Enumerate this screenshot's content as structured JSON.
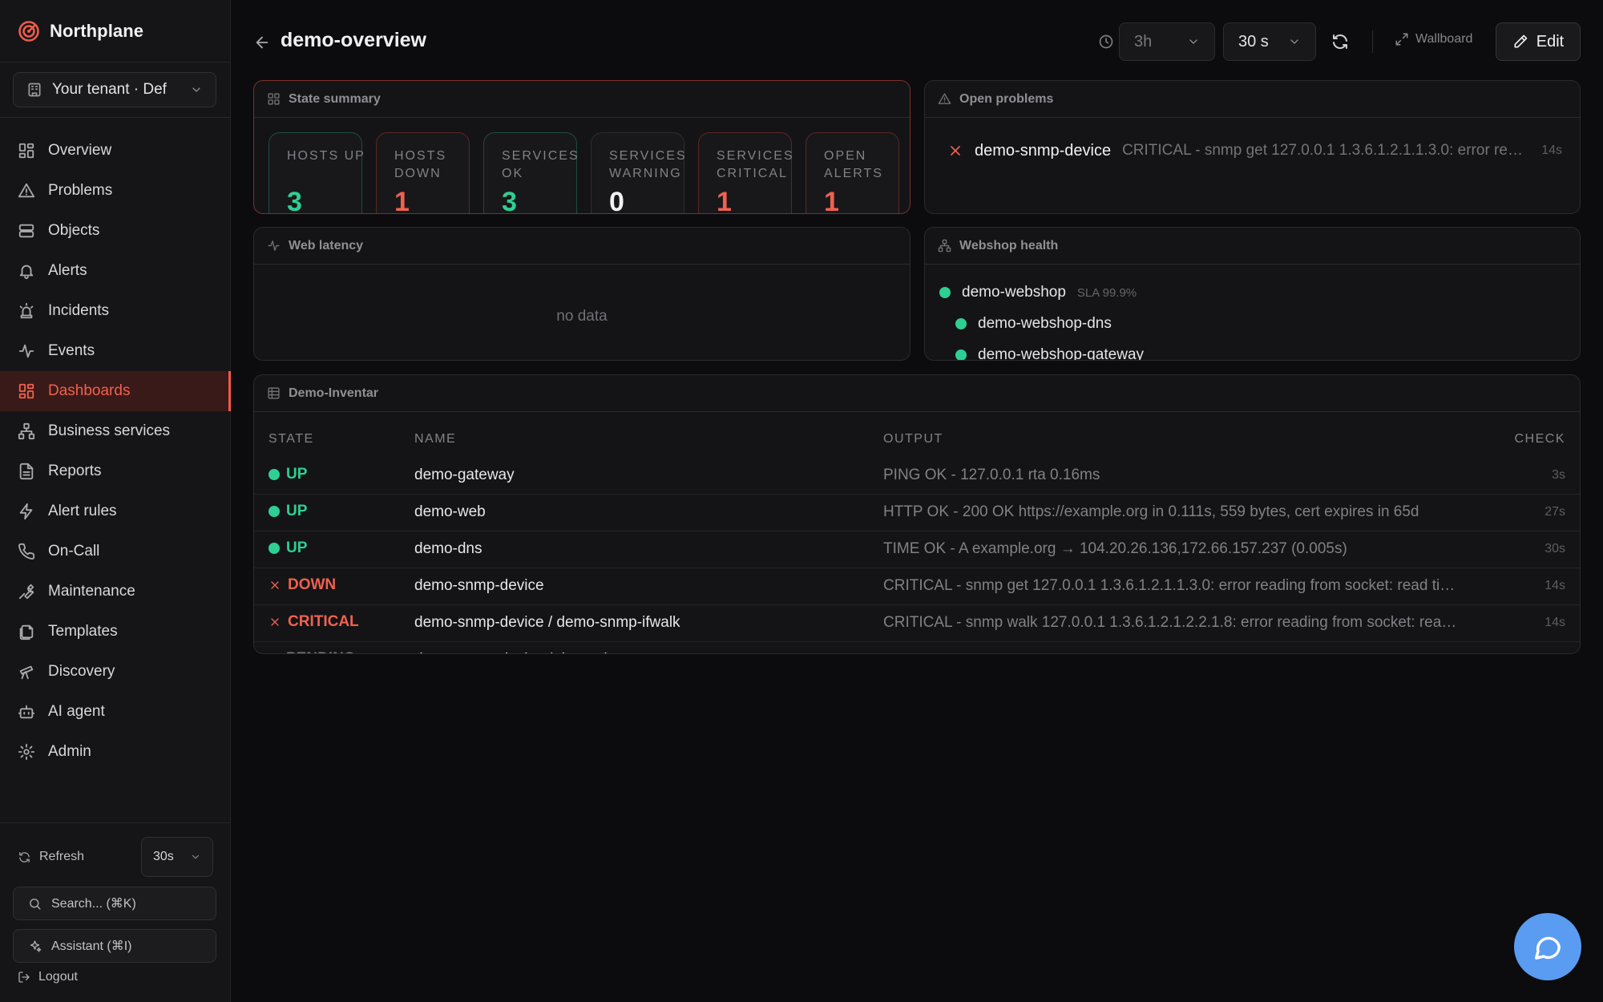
{
  "app": {
    "name": "Northplane"
  },
  "tenant": {
    "label": "Your tenant · Def"
  },
  "nav": [
    {
      "label": "Overview",
      "icon": "layout-dashboard-icon",
      "active": false
    },
    {
      "label": "Problems",
      "icon": "warning-triangle-icon",
      "active": false
    },
    {
      "label": "Objects",
      "icon": "server-icon",
      "active": false
    },
    {
      "label": "Alerts",
      "icon": "bell-icon",
      "active": false
    },
    {
      "label": "Incidents",
      "icon": "siren-icon",
      "active": false
    },
    {
      "label": "Events",
      "icon": "activity-icon",
      "active": false
    },
    {
      "label": "Dashboards",
      "icon": "grid-icon",
      "active": true
    },
    {
      "label": "Business services",
      "icon": "network-icon",
      "active": false
    },
    {
      "label": "Reports",
      "icon": "file-text-icon",
      "active": false
    },
    {
      "label": "Alert rules",
      "icon": "zap-icon",
      "active": false
    },
    {
      "label": "On-Call",
      "icon": "phone-icon",
      "active": false
    },
    {
      "label": "Maintenance",
      "icon": "wrench-icon",
      "active": false
    },
    {
      "label": "Templates",
      "icon": "copy-icon",
      "active": false
    },
    {
      "label": "Discovery",
      "icon": "telescope-icon",
      "active": false
    },
    {
      "label": "AI agent",
      "icon": "bot-icon",
      "active": false
    },
    {
      "label": "Admin",
      "icon": "gear-icon",
      "active": false
    }
  ],
  "sidebar_footer": {
    "refresh_label": "Refresh",
    "refresh_value": "30s",
    "search_placeholder": "Search... (⌘K)",
    "assistant_label": "Assistant (⌘I)",
    "logout_label": "Logout"
  },
  "header": {
    "title": "demo-overview",
    "time_range": "3h",
    "refresh_interval": "30 s",
    "wallboard_label": "Wallboard",
    "edit_label": "Edit"
  },
  "state_summary": {
    "title": "State summary",
    "tiles": [
      {
        "label": "HOSTS UP",
        "value": "3",
        "tone": "green"
      },
      {
        "label": "HOSTS DOWN",
        "value": "1",
        "tone": "red"
      },
      {
        "label": "SERVICES OK",
        "value": "3",
        "tone": "green"
      },
      {
        "label": "SERVICES WARNING",
        "value": "0",
        "tone": "neutral"
      },
      {
        "label": "SERVICES CRITICAL",
        "value": "1",
        "tone": "red"
      },
      {
        "label": "OPEN ALERTS",
        "value": "1",
        "tone": "red"
      }
    ]
  },
  "open_problems": {
    "title": "Open problems",
    "items": [
      {
        "host": "demo-snmp-device",
        "output": "CRITICAL - snmp get 127.0.0.1 1.3.6.1.2.1.1.3.0: error reading from socket: read",
        "age": "14s"
      }
    ]
  },
  "web_latency": {
    "title": "Web latency",
    "empty_text": "no data"
  },
  "webshop_health": {
    "title": "Webshop health",
    "root": {
      "name": "demo-webshop",
      "sla": "SLA 99.9%"
    },
    "children": [
      "demo-webshop-dns",
      "demo-webshop-gateway"
    ]
  },
  "inventory": {
    "title": "Demo-Inventar",
    "columns": [
      "STATE",
      "NAME",
      "OUTPUT",
      "CHECK"
    ],
    "rows": [
      {
        "state": "UP",
        "name": "demo-gateway",
        "output": "PING OK - 127.0.0.1 rta 0.16ms",
        "check": "3s"
      },
      {
        "state": "UP",
        "name": "demo-web",
        "output": "HTTP OK - 200 OK https://example.org in 0.111s, 559 bytes, cert expires in 65d",
        "check": "27s"
      },
      {
        "state": "UP",
        "name": "demo-dns",
        "output": "TIME OK - A example.org → 104.20.26.136,172.66.157.237 (0.005s)",
        "check": "30s"
      },
      {
        "state": "DOWN",
        "name": "demo-snmp-device",
        "output": "CRITICAL - snmp get 127.0.0.1 1.3.6.1.2.1.1.3.0: error reading from socket: read timeout",
        "check": "14s"
      },
      {
        "state": "CRITICAL",
        "name": "demo-snmp-device / demo-snmp-ifwalk",
        "output": "CRITICAL - snmp walk 127.0.0.1 1.3.6.1.2.1.2.2.1.8: error reading from socket: read timeout",
        "check": "14s"
      },
      {
        "state": "PENDING",
        "name": "demo-snmp-device / demo-tls",
        "output": "",
        "check": "—"
      }
    ]
  },
  "colors": {
    "accent": "#ef5b4b",
    "ok": "#2ecf93",
    "critical": "#f0614f",
    "pending": "#77777d",
    "fab": "#5a9cf2"
  }
}
